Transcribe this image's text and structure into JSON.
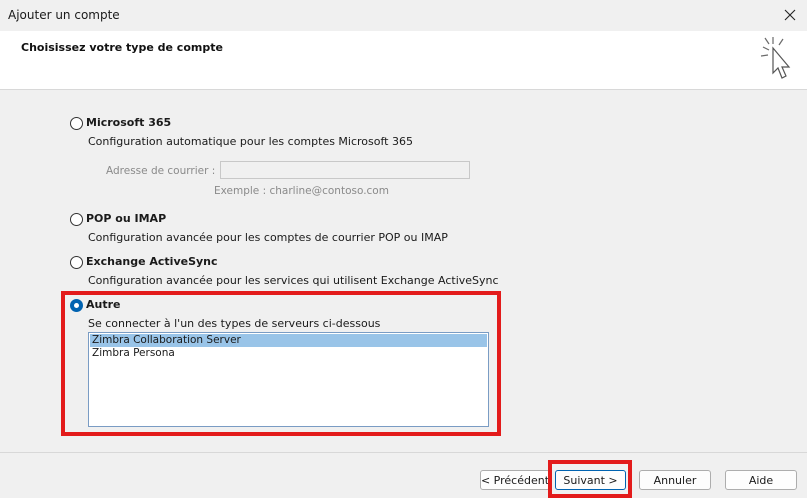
{
  "window": {
    "title": "Ajouter un compte"
  },
  "header": {
    "title": "Choisissez votre type de compte"
  },
  "options": {
    "m365": {
      "label": "Microsoft 365",
      "description": "Configuration automatique pour les comptes Microsoft 365",
      "email_label": "Adresse de courrier :",
      "email_value": "",
      "email_example": "Exemple : charline@contoso.com",
      "checked": false
    },
    "pop": {
      "label": "POP ou IMAP",
      "description": "Configuration avancée pour les comptes de courrier POP ou IMAP",
      "checked": false
    },
    "eas": {
      "label": "Exchange ActiveSync",
      "description": "Configuration avancée pour les services qui utilisent Exchange ActiveSync",
      "checked": false
    },
    "other": {
      "label": "Autre",
      "description": "Se connecter à l'un des types de serveurs ci-dessous",
      "checked": true,
      "server_types": [
        {
          "name": "Zimbra Collaboration Server",
          "selected": true
        },
        {
          "name": "Zimbra Persona",
          "selected": false
        }
      ]
    }
  },
  "footer": {
    "prev_label": "< Précédent",
    "next_label": "Suivant >",
    "cancel_label": "Annuler",
    "help_label": "Aide"
  },
  "colors": {
    "accent": "#0063b1",
    "highlight": "#e31b1b",
    "selection": "#99c4e8"
  },
  "icons": {
    "close": "close-icon",
    "cursor": "pointer-click-icon"
  }
}
